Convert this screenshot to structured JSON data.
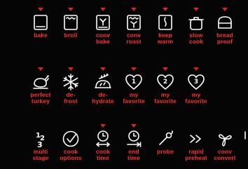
{
  "panel": {
    "accent_color": "#ff3030",
    "indicator_color": "#e02020",
    "background": "#050505",
    "rows": [
      [
        {
          "id": "bake",
          "label": "bake",
          "icon": "bake-icon",
          "indicator": true
        },
        {
          "id": "broil",
          "label": "broil",
          "icon": "broil-icon",
          "indicator": true
        },
        {
          "id": "conv-bake",
          "label": "conv\nbake",
          "icon": "conv-bake-icon",
          "indicator": true
        },
        {
          "id": "conv-roast",
          "label": "conv\nroast",
          "icon": "conv-roast-icon",
          "indicator": true
        },
        {
          "id": "keep-warm",
          "label": "keep\nwarm",
          "icon": "keep-warm-icon",
          "indicator": true
        },
        {
          "id": "slow-cook",
          "label": "slow\ncook",
          "icon": "slow-cook-icon",
          "indicator": true
        },
        {
          "id": "bread-proof",
          "label": "bread\nproof",
          "icon": "bread-proof-icon",
          "indicator": true
        }
      ],
      [
        {
          "id": "perfect-turkey",
          "label": "perfect\nturkey",
          "icon": "turkey-icon",
          "indicator": true
        },
        {
          "id": "defrost",
          "label": "de-\nfrost",
          "icon": "snowflake-icon",
          "indicator": true
        },
        {
          "id": "dehydrate",
          "label": "de-\nhydrate",
          "icon": "dehydrate-icon",
          "indicator": true
        },
        {
          "id": "my-favorite-1",
          "label": "my\nfavorite",
          "icon": "favorite-heart-1-icon",
          "badge": "1",
          "indicator": true
        },
        {
          "id": "my-favorite-2",
          "label": "my\nfavorite",
          "icon": "favorite-heart-2-icon",
          "badge": "2",
          "indicator": true
        },
        {
          "id": "my-favorite-3",
          "label": "my\nfavorite",
          "icon": "favorite-heart-3-icon",
          "badge": "3",
          "indicator": true
        }
      ],
      [
        {
          "id": "multi-stage",
          "label": "multi\nstage",
          "icon": "multi-stage-icon",
          "indicator": false
        },
        {
          "id": "cook-options",
          "label": "cook\noptions",
          "icon": "checkmark-circle-icon",
          "indicator": false
        },
        {
          "id": "cook-time",
          "label": "cook\ntime",
          "icon": "cook-time-icon",
          "indicator": true
        },
        {
          "id": "end-time",
          "label": "end\ntime",
          "icon": "end-time-icon",
          "indicator": true
        },
        {
          "id": "probe",
          "label": "probe",
          "icon": "probe-icon",
          "indicator": false
        },
        {
          "id": "rapid-preheat",
          "label": "rapid\npreheat",
          "icon": "rapid-preheat-icon",
          "indicator": false
        },
        {
          "id": "conv-convert",
          "label": "conv\nconvert",
          "icon": "conv-convert-icon",
          "indicator": false
        }
      ]
    ]
  }
}
